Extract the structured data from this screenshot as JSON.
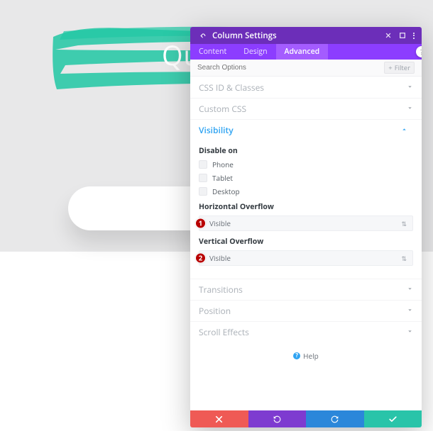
{
  "background": {
    "hero_title": "Qu"
  },
  "panel": {
    "title": "Column Settings",
    "tabs": {
      "content": "Content",
      "design": "Design",
      "advanced": "Advanced",
      "active": "advanced"
    },
    "search": {
      "placeholder": "Search Options",
      "filter_label": "Filter"
    },
    "sections": {
      "css_id_classes": {
        "title": "CSS ID & Classes"
      },
      "custom_css": {
        "title": "Custom CSS"
      },
      "visibility": {
        "title": "Visibility",
        "disable_on_label": "Disable on",
        "options": {
          "phone": "Phone",
          "tablet": "Tablet",
          "desktop": "Desktop"
        },
        "horizontal_overflow": {
          "label": "Horizontal Overflow",
          "value": "Visible"
        },
        "vertical_overflow": {
          "label": "Vertical Overflow",
          "value": "Visible"
        }
      },
      "transitions": {
        "title": "Transitions"
      },
      "position": {
        "title": "Position"
      },
      "scroll_effects": {
        "title": "Scroll Effects"
      }
    },
    "help_label": "Help"
  },
  "callouts": {
    "one": "1",
    "two": "2"
  }
}
